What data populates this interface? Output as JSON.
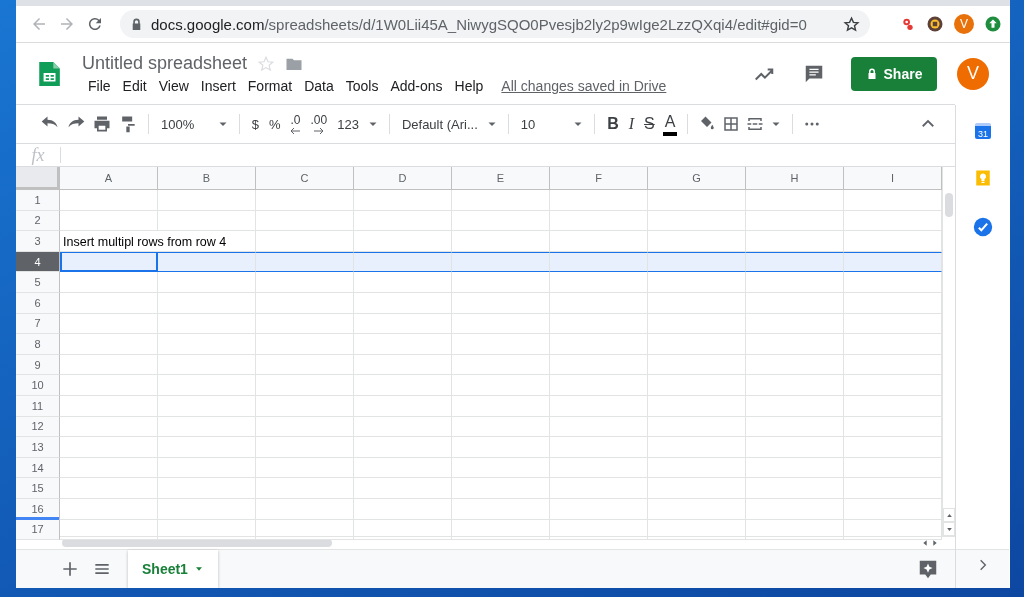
{
  "browser": {
    "url_domain": "docs.google.com",
    "url_path": "/spreadsheets/d/1W0Lii45A_NiwygSQO0Pvesjb2ly2p9wIge2LzzQXqi4/edit#gid=0",
    "profile_initial": "V"
  },
  "document": {
    "title": "Untitled spreadsheet",
    "menu": [
      "File",
      "Edit",
      "View",
      "Insert",
      "Format",
      "Data",
      "Tools",
      "Add-ons",
      "Help"
    ],
    "save_status": "All changes saved in Drive",
    "share_label": "Share",
    "avatar_initial": "V"
  },
  "toolbar": {
    "zoom": "100%",
    "currency": "$",
    "percent": "%",
    "decrease_decimals": ".0",
    "increase_decimals": ".00",
    "more_formats": "123",
    "font": "Default (Ari...",
    "font_size": "10",
    "bold": "B",
    "italic": "I",
    "strikethrough": "S",
    "text_color": "A"
  },
  "formula_bar": {
    "label": "fx"
  },
  "columns": [
    "A",
    "B",
    "C",
    "D",
    "E",
    "F",
    "G",
    "H",
    "I"
  ],
  "rows": [
    {
      "label": "1",
      "selected": false
    },
    {
      "label": "2",
      "selected": false
    },
    {
      "label": "3",
      "selected": false,
      "cells": [
        {
          "text": "Insert multipl rows from row 4",
          "active": false
        }
      ]
    },
    {
      "label": "4",
      "selected": true,
      "cells": [
        {
          "active": true
        }
      ]
    },
    {
      "label": "5",
      "selected": false
    },
    {
      "label": "6",
      "selected": false
    },
    {
      "label": "7",
      "selected": false
    },
    {
      "label": "8",
      "selected": false
    },
    {
      "label": "9",
      "selected": false
    },
    {
      "label": "10",
      "selected": false
    },
    {
      "label": "11",
      "selected": false
    },
    {
      "label": "12",
      "selected": false
    },
    {
      "label": "13",
      "selected": false
    },
    {
      "label": "14",
      "selected": false
    },
    {
      "label": "15",
      "selected": false
    },
    {
      "label": "16",
      "selected": false
    },
    {
      "label": "17",
      "selected": false
    }
  ],
  "sheet_tabs": [
    {
      "label": "Sheet1",
      "selected": true
    }
  ],
  "side_panel": {
    "calendar_label": "31"
  }
}
